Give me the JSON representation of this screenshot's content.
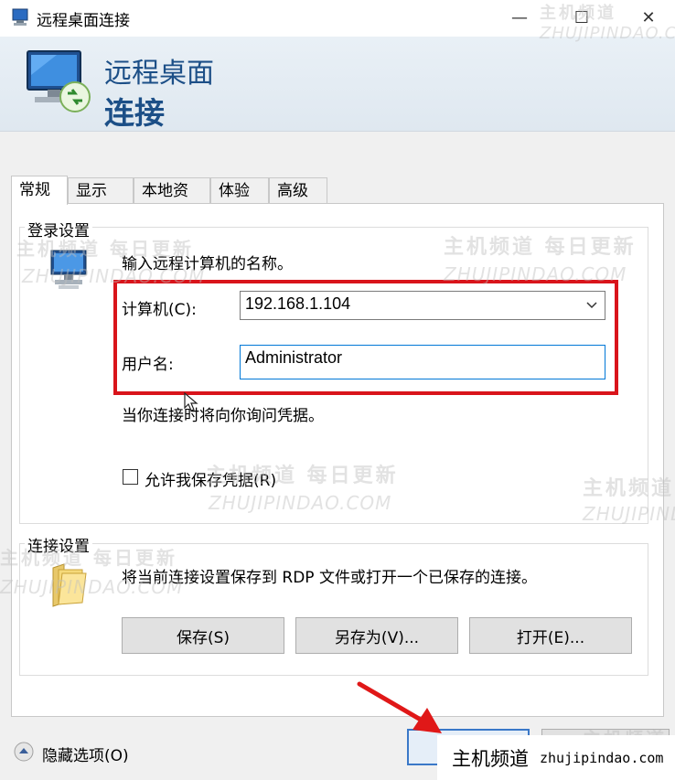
{
  "window": {
    "title": "远程桌面连接",
    "minimize_glyph": "—",
    "maximize_glyph": "☐",
    "close_glyph": "✕"
  },
  "header": {
    "line1": "远程桌面",
    "line2": "连接"
  },
  "tabs": [
    "常规",
    "显示",
    "本地资源",
    "体验",
    "高级"
  ],
  "active_tab": "常规",
  "login": {
    "group_label": "登录设置",
    "prompt": "输入远程计算机的名称。",
    "computer_label": "计算机(C):",
    "computer_value": "192.168.1.104",
    "username_label": "用户名:",
    "username_value": "Administrator",
    "credential_note": "当你连接时将向你询问凭据。",
    "save_credentials_label": "允许我保存凭据(R)",
    "save_credentials_checked": false
  },
  "connection": {
    "group_label": "连接设置",
    "description": "将当前连接设置保存到 RDP 文件或打开一个已保存的连接。",
    "save_label": "保存(S)",
    "save_as_label": "另存为(V)...",
    "open_label": "打开(E)..."
  },
  "footer": {
    "hide_options_label": "隐藏选项(O)"
  },
  "watermark": {
    "cn_text": "主机频道 每日更新",
    "cn_short": "主机频道",
    "en_text": "ZHUJIPINDAO.COM",
    "badge_cn": "主机频道",
    "badge_url": "zhujipindao.com"
  },
  "colors": {
    "highlight_border": "#d9141b",
    "header_text": "#1c4f87",
    "arrow": "#e01818"
  }
}
